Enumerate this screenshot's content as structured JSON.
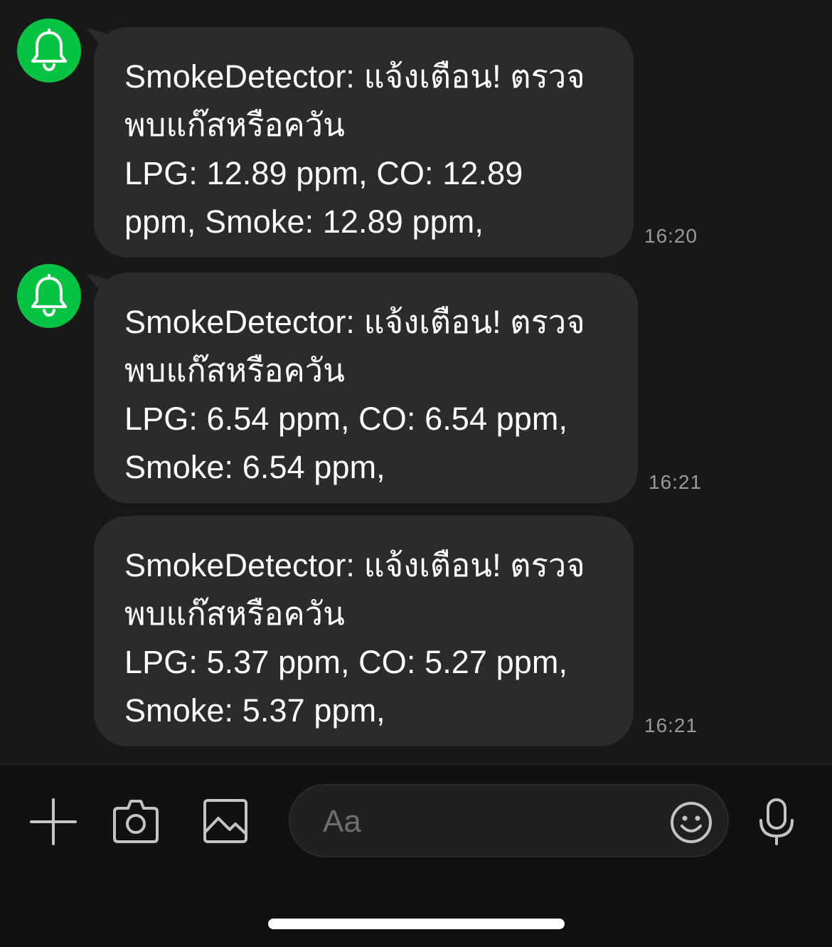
{
  "colors": {
    "background": "#181818",
    "bubble": "#2b2b2b",
    "avatar_green": "#06c341",
    "timestamp": "#9a9a9a",
    "input_bar": "#111111",
    "icon_gray": "#c4c4c4"
  },
  "sender": {
    "avatar_icon": "bell-icon"
  },
  "messages": [
    {
      "text": "SmokeDetector: แจ้งเตือน! ตรวจ\nพบแก๊สหรือควัน\nLPG: 12.89 ppm, CO: 12.89\nppm, Smoke: 12.89 ppm,",
      "time": "16:20"
    },
    {
      "text": "SmokeDetector: แจ้งเตือน! ตรวจ\nพบแก๊สหรือควัน\nLPG: 6.54 ppm, CO: 6.54 ppm,\nSmoke: 6.54 ppm,",
      "time": "16:21"
    },
    {
      "text": "SmokeDetector: แจ้งเตือน! ตรวจ\nพบแก๊สหรือควัน\nLPG: 5.37 ppm, CO: 5.27 ppm,\nSmoke: 5.37 ppm,",
      "time": "16:21"
    }
  ],
  "composer": {
    "placeholder": "Aa",
    "icons": [
      "plus-icon",
      "camera-icon",
      "image-icon",
      "emoji-icon",
      "microphone-icon"
    ]
  }
}
